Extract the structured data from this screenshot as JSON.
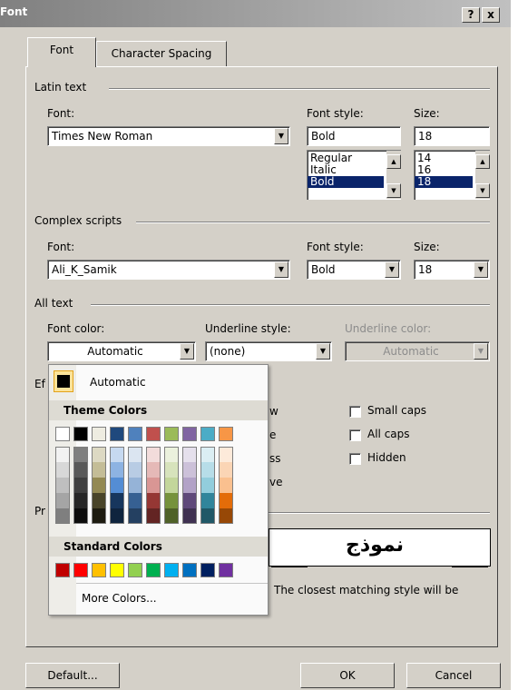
{
  "window": {
    "title": "Font",
    "help_glyph": "?",
    "close_glyph": "x"
  },
  "tabs": [
    {
      "label": "Font",
      "active": true
    },
    {
      "label": "Character Spacing",
      "active": false
    }
  ],
  "latin": {
    "group_label": "Latin text",
    "font_label": "Font:",
    "font_value": "Times New Roman",
    "style_label": "Font style:",
    "style_value": "Bold",
    "style_options": [
      "Regular",
      "Italic",
      "Bold"
    ],
    "style_selected": "Bold",
    "size_label": "Size:",
    "size_value": "18",
    "size_options": [
      "14",
      "16",
      "18"
    ],
    "size_selected": "18"
  },
  "complex": {
    "group_label": "Complex scripts",
    "font_label": "Font:",
    "font_value": "Ali_K_Samik",
    "style_label": "Font style:",
    "style_value": "Bold",
    "size_label": "Size:",
    "size_value": "18"
  },
  "all_text": {
    "group_label": "All text",
    "color_label": "Font color:",
    "color_value": "Automatic",
    "underline_label": "Underline style:",
    "underline_value": "(none)",
    "underline_color_label": "Underline color:",
    "underline_color_value": "Automatic"
  },
  "effects": {
    "label_fragment": "Ef",
    "partial_labels": [
      "w",
      "e",
      "ss",
      "ve"
    ],
    "checkboxes": [
      {
        "label": "Small caps",
        "checked": false
      },
      {
        "label": "All caps",
        "checked": false
      },
      {
        "label": "Hidden",
        "checked": false
      }
    ]
  },
  "preview": {
    "label_fragment": "Pr",
    "sample_text": "نموذج",
    "note": "The closest matching style will be"
  },
  "color_popup": {
    "automatic_label": "Automatic",
    "automatic_color": "#000000",
    "theme_header": "Theme Colors",
    "theme_base": [
      "#ffffff",
      "#000000",
      "#eeece1",
      "#1f497d",
      "#4f81bd",
      "#c0504d",
      "#9bbb59",
      "#8064a2",
      "#4bacc6",
      "#f79646"
    ],
    "theme_shades": [
      [
        "#f2f2f2",
        "#d8d8d8",
        "#bfbfbf",
        "#a5a5a5",
        "#7f7f7f"
      ],
      [
        "#7f7f7f",
        "#595959",
        "#3f3f3f",
        "#262626",
        "#0c0c0c"
      ],
      [
        "#ddd9c3",
        "#c4bd97",
        "#938953",
        "#494429",
        "#1d1b10"
      ],
      [
        "#c6d9f0",
        "#8db3e2",
        "#548dd4",
        "#17365d",
        "#0f243e"
      ],
      [
        "#dbe5f1",
        "#b8cce4",
        "#95b3d7",
        "#366092",
        "#244061"
      ],
      [
        "#f2dcdb",
        "#e5b9b7",
        "#d99694",
        "#953734",
        "#632423"
      ],
      [
        "#ebf1dd",
        "#d7e3bc",
        "#c3d69b",
        "#76923c",
        "#4f6128"
      ],
      [
        "#e5e0ec",
        "#ccc1d9",
        "#b2a2c7",
        "#5f497a",
        "#3f3151"
      ],
      [
        "#dbeef3",
        "#b7dde8",
        "#92cddc",
        "#31859b",
        "#205867"
      ],
      [
        "#fdeada",
        "#fbd5b5",
        "#fac08f",
        "#e36c09",
        "#974806"
      ]
    ],
    "standard_header": "Standard Colors",
    "standard": [
      "#c00000",
      "#ff0000",
      "#ffc000",
      "#ffff00",
      "#92d050",
      "#00b050",
      "#00b0f0",
      "#0070c0",
      "#002060",
      "#7030a0"
    ],
    "more_label": "More Colors..."
  },
  "buttons": {
    "default": "Default...",
    "ok": "OK",
    "cancel": "Cancel"
  }
}
